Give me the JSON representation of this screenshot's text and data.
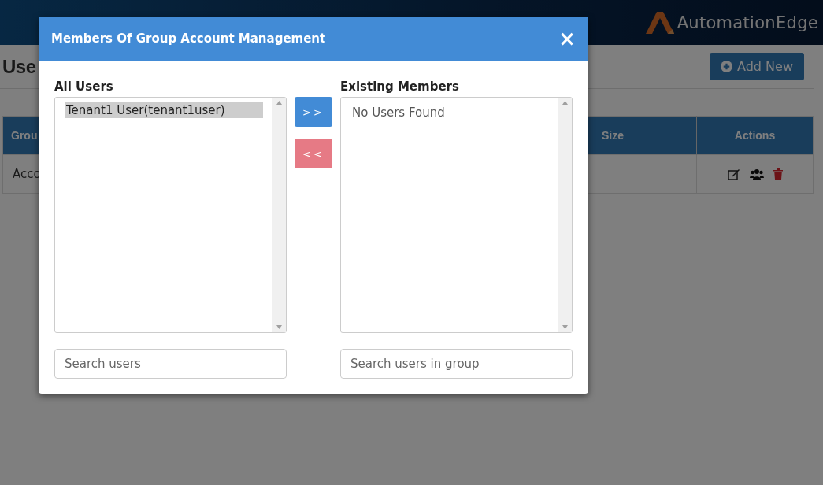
{
  "header": {
    "logo": "AutomationEdge"
  },
  "page": {
    "title": "Use",
    "add_button": "Add New"
  },
  "table": {
    "columns": [
      {
        "label": "Grou",
        "kind": "text"
      },
      {
        "label": "Size",
        "kind": "text"
      },
      {
        "label": "Actions",
        "kind": "actions"
      }
    ],
    "rows": [
      {
        "group": "Acco"
      }
    ]
  },
  "dialog": {
    "title": "Members Of Group Account Management",
    "close": "×",
    "all_users": {
      "label": "All Users",
      "items": [
        {
          "name": "Tenant1 User(tenant1user)",
          "selected": true
        }
      ],
      "search": {
        "placeholder": "Search users"
      }
    },
    "add_button": ">>",
    "remove_button": "<<",
    "existing": {
      "label": "Existing Members",
      "empty_message": "No Users Found",
      "search": {
        "placeholder": "Search users in group"
      }
    }
  }
}
